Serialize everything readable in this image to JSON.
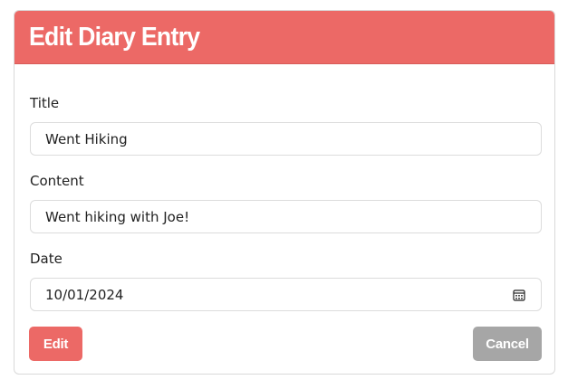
{
  "header": {
    "title": "Edit Diary Entry"
  },
  "form": {
    "title_label": "Title",
    "title_value": "Went Hiking",
    "content_label": "Content",
    "content_value": "Went hiking with Joe!",
    "date_label": "Date",
    "date_value": "10/01/2024"
  },
  "actions": {
    "edit_label": "Edit",
    "cancel_label": "Cancel"
  },
  "colors": {
    "accent": "#ec6966",
    "cancel": "#a6a6a6"
  },
  "icons": {
    "date_picker": "calendar-icon"
  }
}
